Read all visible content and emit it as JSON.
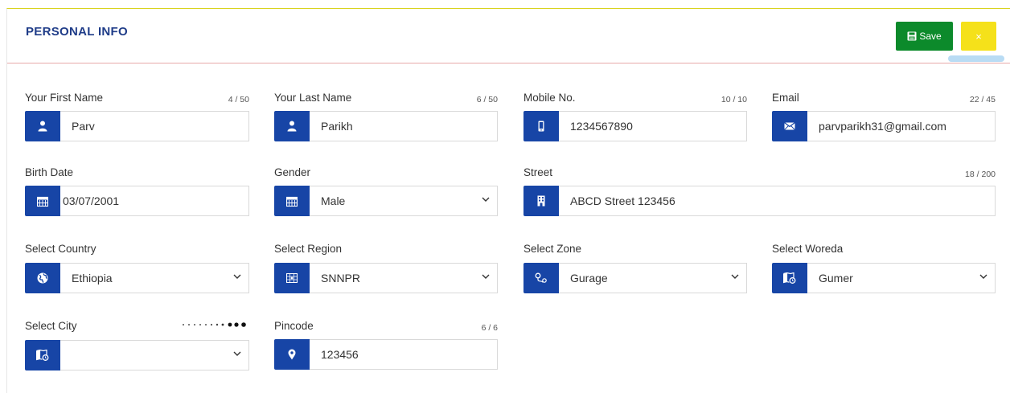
{
  "header": {
    "title": "PERSONAL INFO",
    "save_label": "Save",
    "close_label": "×"
  },
  "fields": {
    "first_name": {
      "label": "Your First Name",
      "value": "Parv",
      "counter": "4 / 50",
      "icon": "user-icon"
    },
    "last_name": {
      "label": "Your Last Name",
      "value": "Parikh",
      "counter": "6 / 50",
      "icon": "user-icon"
    },
    "mobile": {
      "label": "Mobile No.",
      "value": "1234567890",
      "counter": "10 / 10",
      "icon": "mobile-icon"
    },
    "email": {
      "label": "Email",
      "value": "parvparikh31@gmail.com",
      "counter": "22 / 45",
      "icon": "envelope-icon"
    },
    "birth_date": {
      "label": "Birth Date",
      "value": "03/07/2001",
      "icon": "calendar-icon"
    },
    "gender": {
      "label": "Gender",
      "value": "Male",
      "icon": "calendar-icon"
    },
    "street": {
      "label": "Street",
      "value": "ABCD Street 123456",
      "counter": "18 / 200",
      "icon": "building-icon"
    },
    "country": {
      "label": "Select Country",
      "value": "Ethiopia",
      "icon": "globe-icon"
    },
    "region": {
      "label": "Select Region",
      "value": "SNNPR",
      "icon": "map-icon"
    },
    "zone": {
      "label": "Select Zone",
      "value": "Gurage",
      "icon": "route-icon"
    },
    "woreda": {
      "label": "Select Woreda",
      "value": "Gumer",
      "icon": "map-marker-icon"
    },
    "city": {
      "label": "Select City",
      "value": "",
      "icon": "map-marker-icon"
    },
    "pincode": {
      "label": "Pincode",
      "value": "123456",
      "counter": "6 / 6",
      "icon": "location-pin-icon"
    }
  },
  "colors": {
    "accent_blue": "#1745a6",
    "title_blue": "#1f3c88",
    "save_green": "#0c8a2b",
    "close_yellow": "#f5e11a",
    "header_rule": "#e7a9a9"
  }
}
